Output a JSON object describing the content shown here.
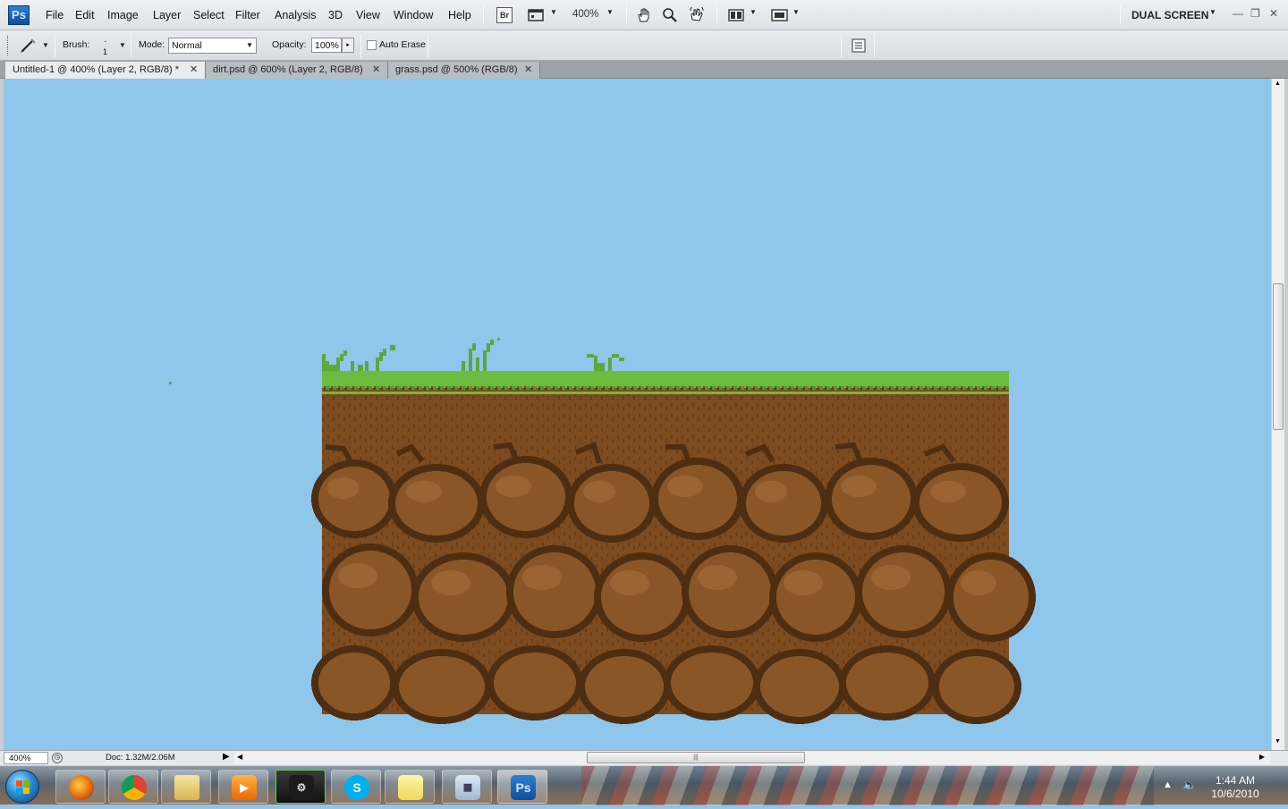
{
  "app": {
    "logo_text": "Ps",
    "menus": [
      "File",
      "Edit",
      "Image",
      "Layer",
      "Select",
      "Filter",
      "Analysis",
      "3D",
      "View",
      "Window",
      "Help"
    ],
    "bridge_label": "Br",
    "zoom_level": "400%",
    "workspace": "DUAL SCREEN"
  },
  "options": {
    "brush_label": "Brush:",
    "brush_size": "1",
    "mode_label": "Mode:",
    "mode_value": "Normal",
    "opacity_label": "Opacity:",
    "opacity_value": "100%",
    "auto_erase_label": "Auto Erase",
    "auto_erase_checked": false
  },
  "tabs": [
    {
      "label": "Untitled-1 @ 400% (Layer 2, RGB/8) *",
      "active": true
    },
    {
      "label": "dirt.psd @ 600% (Layer 2, RGB/8)",
      "active": false
    },
    {
      "label": "grass.psd @ 500% (RGB/8)",
      "active": false
    }
  ],
  "canvas": {
    "background_color": "#8fc6ec",
    "grass_color": "#6cbc3f",
    "grass_dark_color": "#4f9a2c",
    "dirt_color": "#7c4b20",
    "rock_color": "#8a5628",
    "crack_color": "#4e2e12"
  },
  "status": {
    "zoom": "400%",
    "doc_size": "Doc: 1.32M/2.06M"
  },
  "taskbar": {
    "apps": [
      "firefox-icon",
      "chrome-icon",
      "explorer-icon",
      "media-player-icon",
      "steam-icon",
      "skype-icon",
      "sticky-notes-icon",
      "calculator-icon",
      "photoshop-icon"
    ],
    "clock_time": "1:44 AM",
    "clock_date": "10/6/2010"
  }
}
